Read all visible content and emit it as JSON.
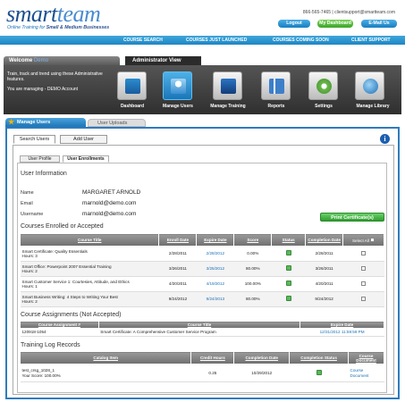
{
  "header": {
    "logo_main": "smart",
    "logo_accent": "team",
    "tagline_prefix": "Online Training for ",
    "tagline_bold": "Small & Medium Businesses",
    "contact": "866-565-7465  |  clientsupport@smartteam.com",
    "logout": "Logout",
    "dashboard": "My Dashboard",
    "email_us": "E-Mail Us"
  },
  "nav": [
    "COURSE SEARCH",
    "COURSES JUST LAUNCHED",
    "COURSES COMING SOON",
    "CLIENT SUPPORT"
  ],
  "welcome": {
    "label": "Welcome",
    "name": "Demo"
  },
  "admin_tab": "Administrator View",
  "dash_text": {
    "line1": "Train, track and trend using these Administrative features.",
    "line2": "You are managing - DEMO Account"
  },
  "dash_icons": [
    {
      "label": "Dashboard",
      "icon": "dashboard-icon"
    },
    {
      "label": "Manage Users",
      "icon": "users-icon"
    },
    {
      "label": "Manage Training",
      "icon": "training-icon"
    },
    {
      "label": "Reports",
      "icon": "reports-icon"
    },
    {
      "label": "Settings",
      "icon": "settings-icon"
    },
    {
      "label": "Manage Library",
      "icon": "library-icon"
    }
  ],
  "tabs": {
    "manage_users": "Manage Users",
    "user_uploads": "User Uploads",
    "search_users": "Search Users",
    "add_user": "Add User",
    "user_profile": "User Profile",
    "user_enrollments": "User Enrollments"
  },
  "user_info": {
    "title": "User Information",
    "name_label": "Name",
    "name": "MARGARET ARNOLD",
    "email_label": "Email",
    "email": "marnold@demo.com",
    "username_label": "Username",
    "username": "marnold@demo.com"
  },
  "print_btn": "Print Certificate(s)",
  "enrolled": {
    "title": "Courses Enrolled or Accepted",
    "headers": [
      "Course Title",
      "Enroll Date",
      "Expire Date",
      "Score",
      "Status",
      "Completion Date",
      "Select All"
    ],
    "rows": [
      {
        "title": "Smart Certificate: Quality Essentials",
        "hours": "Hours: 3",
        "enroll": "2/28/2011",
        "expire": "2/28/2012",
        "score": "0.00%",
        "completion": "2/28/2011"
      },
      {
        "title": "Smart Office: Powerpoint 2007 Essential Training",
        "hours": "Hours: 2",
        "enroll": "3/26/2011",
        "expire": "3/25/2012",
        "score": "80.00%",
        "completion": "3/26/2011"
      },
      {
        "title": "Smart Customer Service 1: Courtesies, Attitude, and Ethics",
        "hours": "Hours: 1",
        "enroll": "4/20/2011",
        "expire": "4/19/2012",
        "score": "100.00%",
        "completion": "4/20/2011"
      },
      {
        "title": "Smart Business Writing: 4 Steps to Writing Your Best",
        "hours": "Hours: 2",
        "enroll": "9/24/2012",
        "expire": "9/24/2013",
        "score": "80.00%",
        "completion": "9/24/2012"
      }
    ]
  },
  "assignments": {
    "title": "Course Assignments (Not Accepted)",
    "headers": [
      "Course Assignment #",
      "Course Title",
      "Expire Date"
    ],
    "rows": [
      {
        "num": "120918-1054",
        "title": "Smart Certificate: A Comprehensive Customer Service Program",
        "expire": "12/31/2012 11:59:59 PM"
      }
    ]
  },
  "training_log": {
    "title": "Training Log Records",
    "headers": [
      "Catalog Item",
      "Credit Hours",
      "Completion Date",
      "Completion Status",
      "Course Document"
    ],
    "rows": [
      {
        "item": "test_crsg_1028_1",
        "score": "Your Score: 100.00%",
        "hours": "0.25",
        "date": "10/29/2012",
        "doc": "Course Document"
      }
    ]
  },
  "colors": {
    "brand_blue": "#1b4f8f",
    "nav_blue": "#1d86c4",
    "accent_green": "#5cb85c"
  }
}
